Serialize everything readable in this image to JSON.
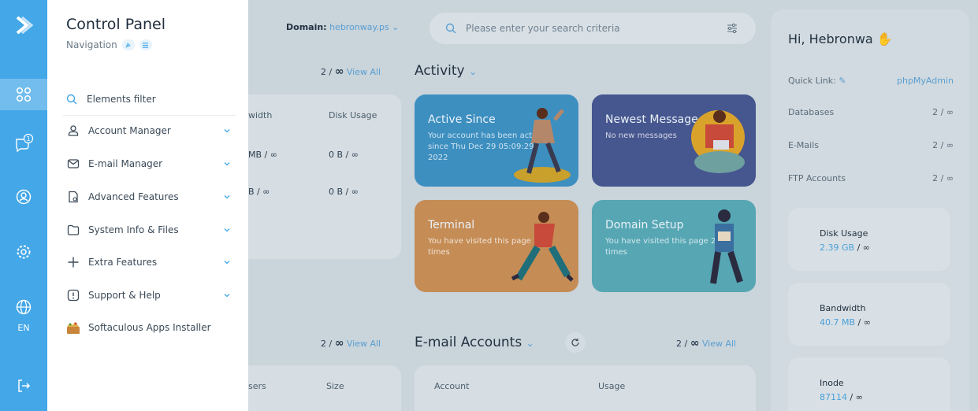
{
  "rail": {
    "language": "EN",
    "badge_count": "1",
    "accent": "#43a7e8"
  },
  "nav": {
    "title": "Control Panel",
    "subtitle": "Navigation",
    "filter_label": "Elements filter",
    "items": [
      {
        "label": "Account Manager",
        "icon": "user-icon"
      },
      {
        "label": "E-mail Manager",
        "icon": "mail-icon"
      },
      {
        "label": "Advanced Features",
        "icon": "advanced-file-icon"
      },
      {
        "label": "System Info & Files",
        "icon": "folder-icon"
      },
      {
        "label": "Extra Features",
        "icon": "plus-icon"
      },
      {
        "label": "Support & Help",
        "icon": "alert-box-icon"
      },
      {
        "label": "Softaculous Apps Installer",
        "icon": "softaculous-icon"
      }
    ]
  },
  "header": {
    "domain_label": "Domain:",
    "domain_value": "hebronway.ps",
    "search_placeholder": "Please enter your search criteria"
  },
  "left_panel": {
    "count": "2 /",
    "view_all": "View All",
    "col_bandwidth": "width",
    "col_disk": "Disk Usage",
    "rows": [
      {
        "bandwidth": "MB / ∞",
        "disk": "0 B / ∞"
      },
      {
        "bandwidth": "B / ∞",
        "disk": "0 B / ∞"
      }
    ]
  },
  "activity": {
    "title": "Activity",
    "tiles": [
      {
        "title": "Active Since",
        "desc": "Your account has been active since Thu Dec 29 05:09:29 2022",
        "color": "#3d8fc0"
      },
      {
        "title": "Newest Message",
        "desc": "No new messages",
        "color": "#46568f"
      },
      {
        "title": "Terminal",
        "desc": "You have visited this page 29 times",
        "color": "#c58c55"
      },
      {
        "title": "Domain Setup",
        "desc": "You have visited this page 26 times",
        "color": "#56a6b4"
      }
    ]
  },
  "bottom_left": {
    "count": "2 /",
    "view_all": "View All",
    "col_users": "sers",
    "col_size": "Size"
  },
  "email_accounts": {
    "title": "E-mail Accounts",
    "count": "2 /",
    "view_all": "View All",
    "col_account": "Account",
    "col_usage": "Usage"
  },
  "right": {
    "greeting": "Hi, Hebronwa",
    "quick_link_label": "Quick Link:",
    "quick_link_value": "phpMyAdmin",
    "rows": [
      {
        "label": "Databases",
        "value": "2 / ∞"
      },
      {
        "label": "E-Mails",
        "value": "2 / ∞"
      },
      {
        "label": "FTP Accounts",
        "value": "2 / ∞"
      }
    ],
    "stats": [
      {
        "label": "Disk Usage",
        "value": "2.39 GB",
        "limit": "/ ∞"
      },
      {
        "label": "Bandwidth",
        "value": "40.7 MB",
        "limit": "/ ∞"
      },
      {
        "label": "Inode",
        "value": "87114",
        "limit": "/ ∞"
      }
    ]
  }
}
